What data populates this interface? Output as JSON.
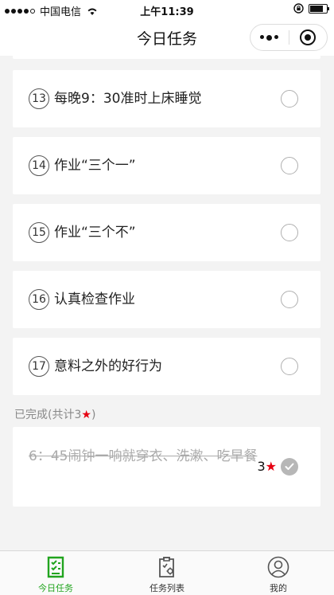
{
  "status_bar": {
    "carrier": "中国电信",
    "time": "上午11:39"
  },
  "nav": {
    "title": "今日任务"
  },
  "tasks": [
    {
      "num": "13",
      "text": "每晚9：30准时上床睡觉"
    },
    {
      "num": "14",
      "text": "作业“三个一”"
    },
    {
      "num": "15",
      "text": "作业“三个不”"
    },
    {
      "num": "16",
      "text": "认真检查作业"
    },
    {
      "num": "17",
      "text": "意料之外的好行为"
    }
  ],
  "completed": {
    "label_prefix": "已完成(共计3",
    "label_star": "★",
    "label_suffix": ")",
    "items": [
      {
        "text": "6：45闹钟一响就穿衣、洗漱、吃早餐",
        "stars": "3",
        "star_glyph": "★"
      }
    ]
  },
  "tab_bar": {
    "items": [
      {
        "label": "今日任务",
        "active": true
      },
      {
        "label": "任务列表",
        "active": false
      },
      {
        "label": "我的",
        "active": false
      }
    ]
  },
  "colors": {
    "accent": "#21a41e",
    "star": "#e60012"
  }
}
